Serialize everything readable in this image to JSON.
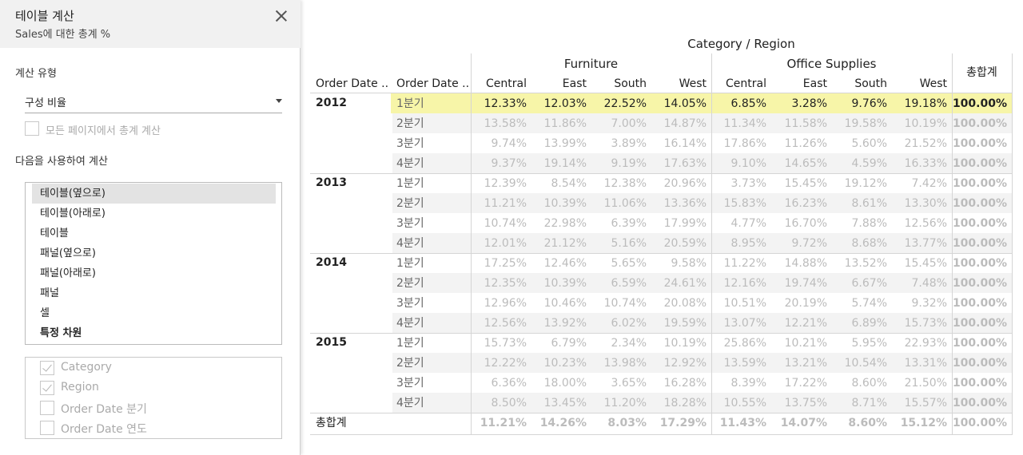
{
  "dialog": {
    "title": "테이블 계산",
    "subtitle": "Sales에 대한 총계 %",
    "calc_type_label": "계산 유형",
    "calc_type_value": "구성 비율",
    "all_pages_label": "모든 페이지에서 총계 계산",
    "compute_using_label": "다음을 사용하여 계산",
    "compute_options": [
      "테이블(옆으로)",
      "테이블(아래로)",
      "테이블",
      "패널(옆으로)",
      "패널(아래로)",
      "패널",
      "셀",
      "특정 차원"
    ],
    "selected_option": "테이블(옆으로)",
    "dimensions": [
      {
        "label": "Category",
        "checked": true
      },
      {
        "label": "Region",
        "checked": true
      },
      {
        "label": "Order Date 분기",
        "checked": false
      },
      {
        "label": "Order Date 연도",
        "checked": false
      }
    ]
  },
  "table": {
    "col_title": "Category / Region",
    "categories": [
      "Furniture",
      "Office Supplies"
    ],
    "regions": [
      "Central",
      "East",
      "South",
      "West"
    ],
    "row_headers": [
      "Order Date ..",
      "Order Date .."
    ],
    "grand_total_label": "총합계",
    "highlight_color": "#f7f5a8",
    "years": [
      {
        "year": "2012",
        "quarters": [
          {
            "q": "1분기",
            "values": [
              "12.33%",
              "12.03%",
              "22.52%",
              "14.05%",
              "6.85%",
              "3.28%",
              "9.76%",
              "19.18%",
              "100.00%"
            ]
          },
          {
            "q": "2분기",
            "values": [
              "13.58%",
              "11.86%",
              "7.00%",
              "14.87%",
              "11.34%",
              "11.58%",
              "19.58%",
              "10.19%",
              "100.00%"
            ]
          },
          {
            "q": "3분기",
            "values": [
              "9.74%",
              "13.99%",
              "3.89%",
              "16.14%",
              "17.86%",
              "11.26%",
              "5.60%",
              "21.52%",
              "100.00%"
            ]
          },
          {
            "q": "4분기",
            "values": [
              "9.37%",
              "19.14%",
              "9.19%",
              "17.63%",
              "9.10%",
              "14.65%",
              "4.59%",
              "16.33%",
              "100.00%"
            ]
          }
        ]
      },
      {
        "year": "2013",
        "quarters": [
          {
            "q": "1분기",
            "values": [
              "12.39%",
              "8.54%",
              "12.38%",
              "20.96%",
              "3.73%",
              "15.45%",
              "19.12%",
              "7.42%",
              "100.00%"
            ]
          },
          {
            "q": "2분기",
            "values": [
              "11.21%",
              "10.39%",
              "11.06%",
              "13.36%",
              "15.83%",
              "16.23%",
              "8.61%",
              "13.30%",
              "100.00%"
            ]
          },
          {
            "q": "3분기",
            "values": [
              "10.74%",
              "22.98%",
              "6.39%",
              "17.99%",
              "4.77%",
              "16.70%",
              "7.88%",
              "12.56%",
              "100.00%"
            ]
          },
          {
            "q": "4분기",
            "values": [
              "12.01%",
              "21.12%",
              "5.16%",
              "20.59%",
              "8.95%",
              "9.72%",
              "8.68%",
              "13.77%",
              "100.00%"
            ]
          }
        ]
      },
      {
        "year": "2014",
        "quarters": [
          {
            "q": "1분기",
            "values": [
              "17.25%",
              "12.46%",
              "5.65%",
              "9.58%",
              "11.22%",
              "14.88%",
              "13.52%",
              "15.45%",
              "100.00%"
            ]
          },
          {
            "q": "2분기",
            "values": [
              "12.35%",
              "10.39%",
              "6.59%",
              "24.61%",
              "12.16%",
              "19.74%",
              "6.67%",
              "7.48%",
              "100.00%"
            ]
          },
          {
            "q": "3분기",
            "values": [
              "12.96%",
              "10.46%",
              "10.74%",
              "20.08%",
              "10.51%",
              "20.19%",
              "5.74%",
              "9.32%",
              "100.00%"
            ]
          },
          {
            "q": "4분기",
            "values": [
              "12.56%",
              "13.92%",
              "6.02%",
              "19.59%",
              "13.07%",
              "12.21%",
              "6.89%",
              "15.73%",
              "100.00%"
            ]
          }
        ]
      },
      {
        "year": "2015",
        "quarters": [
          {
            "q": "1분기",
            "values": [
              "15.73%",
              "6.79%",
              "2.34%",
              "10.19%",
              "25.86%",
              "10.21%",
              "5.95%",
              "22.93%",
              "100.00%"
            ]
          },
          {
            "q": "2분기",
            "values": [
              "12.22%",
              "10.23%",
              "13.98%",
              "12.92%",
              "13.59%",
              "13.21%",
              "10.54%",
              "13.31%",
              "100.00%"
            ]
          },
          {
            "q": "3분기",
            "values": [
              "6.36%",
              "18.00%",
              "3.65%",
              "16.28%",
              "8.39%",
              "17.22%",
              "8.60%",
              "21.50%",
              "100.00%"
            ]
          },
          {
            "q": "4분기",
            "values": [
              "8.50%",
              "13.45%",
              "11.20%",
              "18.28%",
              "10.55%",
              "13.75%",
              "8.71%",
              "15.57%",
              "100.00%"
            ]
          }
        ]
      }
    ],
    "grand_total_values": [
      "11.21%",
      "14.26%",
      "8.03%",
      "17.29%",
      "11.43%",
      "14.07%",
      "8.60%",
      "15.12%",
      "100.00%"
    ]
  }
}
